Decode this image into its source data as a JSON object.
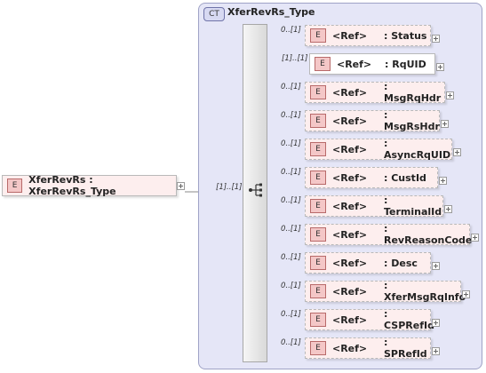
{
  "complex_type": {
    "badge": "CT",
    "name": "XferRevRs_Type"
  },
  "root_element": {
    "badge": "E",
    "label": "XferRevRs : XferRevRs_Type",
    "cardinality": "[1]..[1]"
  },
  "children": [
    {
      "badge": "E",
      "ref": "<Ref>",
      "name": ": Status",
      "cardinality": "0..[1]",
      "optional": true
    },
    {
      "badge": "E",
      "ref": "<Ref>",
      "name": ": RqUID",
      "cardinality": "[1]..[1]",
      "optional": false
    },
    {
      "badge": "E",
      "ref": "<Ref>",
      "name": ": MsgRqHdr",
      "cardinality": "0..[1]",
      "optional": true
    },
    {
      "badge": "E",
      "ref": "<Ref>",
      "name": ": MsgRsHdr",
      "cardinality": "0..[1]",
      "optional": true
    },
    {
      "badge": "E",
      "ref": "<Ref>",
      "name": ": AsyncRqUID",
      "cardinality": "0..[1]",
      "optional": true
    },
    {
      "badge": "E",
      "ref": "<Ref>",
      "name": ": CustId",
      "cardinality": "0..[1]",
      "optional": true
    },
    {
      "badge": "E",
      "ref": "<Ref>",
      "name": ": TerminalId",
      "cardinality": "0..[1]",
      "optional": true
    },
    {
      "badge": "E",
      "ref": "<Ref>",
      "name": ": RevReasonCode",
      "cardinality": "0..[1]",
      "optional": true
    },
    {
      "badge": "E",
      "ref": "<Ref>",
      "name": ": Desc",
      "cardinality": "0..[1]",
      "optional": true
    },
    {
      "badge": "E",
      "ref": "<Ref>",
      "name": ": XferMsgRqInfo",
      "cardinality": "0..[1]",
      "optional": true
    },
    {
      "badge": "E",
      "ref": "<Ref>",
      "name": ": CSPRefId",
      "cardinality": "0..[1]",
      "optional": true
    },
    {
      "badge": "E",
      "ref": "<Ref>",
      "name": ": SPRefId",
      "cardinality": "0..[1]",
      "optional": true
    }
  ]
}
